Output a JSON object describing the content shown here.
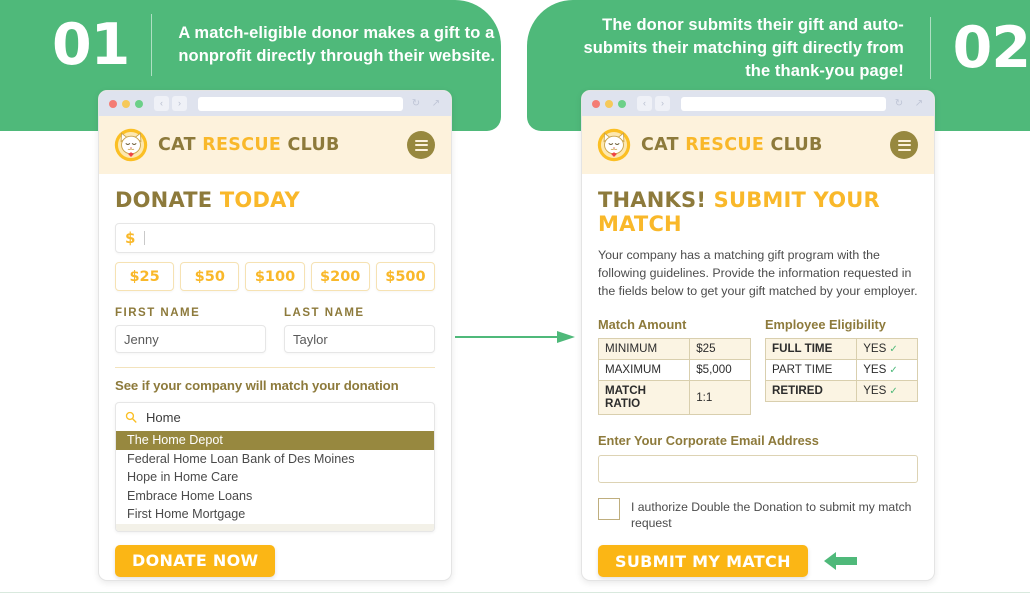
{
  "steps": [
    {
      "number": "01",
      "text": "A match-eligible donor makes a gift to a nonprofit directly through their website."
    },
    {
      "number": "02",
      "text": "The donor submits their gift and auto-submits their matching gift directly from the thank-you page!"
    }
  ],
  "colors": {
    "green": "#4fb97a",
    "gold": "#97883f",
    "yellow": "#fbb615",
    "cream": "#fdf2dc",
    "table_row": "#fbf4e3"
  },
  "brand": {
    "part1": "CAT ",
    "part2": "RESCUE ",
    "part3": "CLUB"
  },
  "browser_chrome": {
    "reload_icon": "↻",
    "expand_icon": "↗",
    "back_icon": "‹",
    "forward_icon": "›",
    "url": ""
  },
  "left_page": {
    "heading_a": "DONATE ",
    "heading_b": "TODAY",
    "currency_symbol": "$",
    "amount_value": "",
    "amount_buttons": [
      "$25",
      "$50",
      "$100",
      "$200",
      "$500"
    ],
    "first_name_label": "FIRST NAME",
    "first_name_value": "Jenny",
    "last_name_label": "LAST NAME",
    "last_name_value": "Taylor",
    "match_prompt": "See if your company will match your donation",
    "search_icon": "search-icon",
    "search_value": "Home",
    "suggestions": [
      {
        "label": "The Home Depot",
        "selected": true
      },
      {
        "label": "Federal Home Loan Bank of Des Moines",
        "selected": false
      },
      {
        "label": "Hope in Home Care",
        "selected": false
      },
      {
        "label": "Embrace Home Loans",
        "selected": false
      },
      {
        "label": "First Home Mortgage",
        "selected": false
      }
    ],
    "cta_label": "DONATE NOW"
  },
  "right_page": {
    "heading_a": "THANKS! ",
    "heading_b": "SUBMIT YOUR MATCH",
    "paragraph": "Your company has a matching gift program with the following guidelines. Provide the information requested in the fields below to get your gift matched by your employer.",
    "match_amount": {
      "caption": "Match Amount",
      "rows": [
        {
          "key": "MINIMUM",
          "value": "$25",
          "bold": false
        },
        {
          "key": "MAXIMUM",
          "value": "$5,000",
          "bold": false
        },
        {
          "key": "MATCH RATIO",
          "value": "1:1",
          "bold": true
        }
      ]
    },
    "employee_eligibility": {
      "caption": "Employee Eligibility",
      "check_icon": "✓",
      "rows": [
        {
          "key": "FULL TIME",
          "value": "YES",
          "bold": true
        },
        {
          "key": "PART TIME",
          "value": "YES",
          "bold": false
        },
        {
          "key": "RETIRED",
          "value": "YES",
          "bold": true
        }
      ]
    },
    "email_label": "Enter Your Corporate Email Address",
    "email_value": "",
    "authorize_text": "I authorize Double the Donation to submit my match request",
    "authorize_checked": false,
    "cta_label": "SUBMIT MY MATCH"
  }
}
